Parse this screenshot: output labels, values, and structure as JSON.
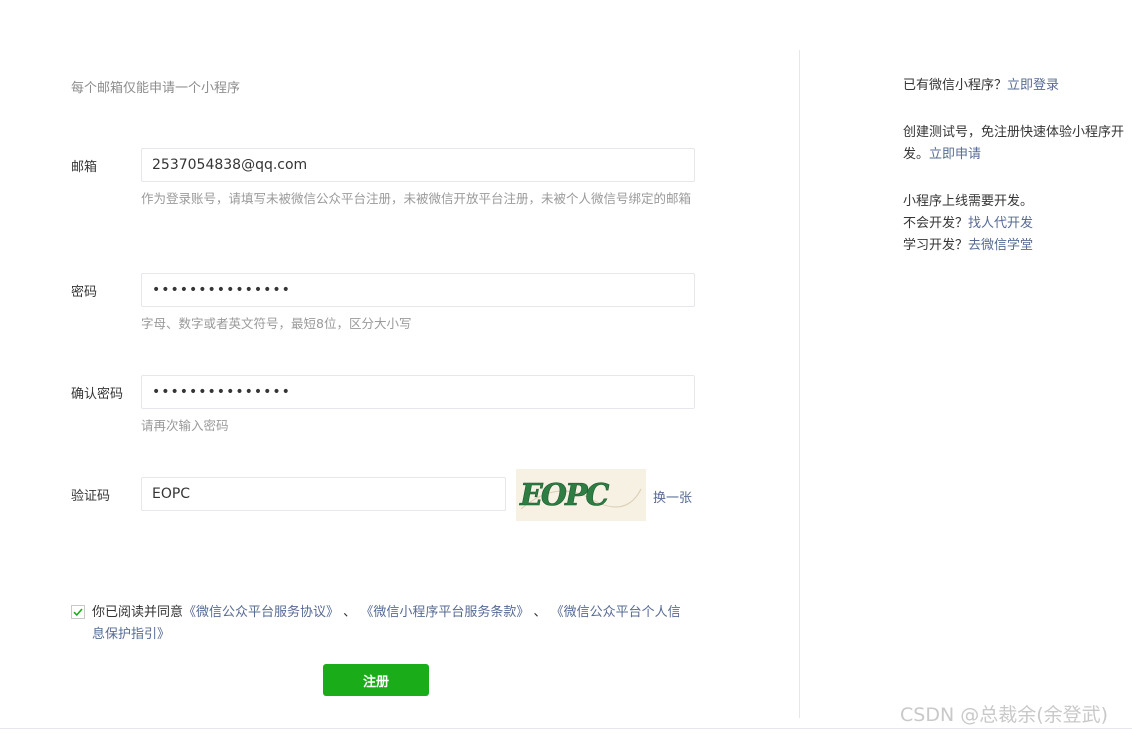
{
  "form": {
    "tip": "每个邮箱仅能申请一个小程序",
    "email": {
      "label": "邮箱",
      "value": "2537054838@qq.com",
      "help": "作为登录账号，请填写未被微信公众平台注册，未被微信开放平台注册，未被个人微信号绑定的邮箱"
    },
    "password": {
      "label": "密码",
      "value": "•••••••••••••••",
      "help": "字母、数字或者英文符号，最短8位，区分大小写"
    },
    "confirm": {
      "label": "确认密码",
      "value": "•••••••••••••••",
      "help": "请再次输入密码"
    },
    "captcha": {
      "label": "验证码",
      "value": "EOPC",
      "image_text": "EOPC",
      "swap_label": "换一张"
    },
    "agreement": {
      "checked": true,
      "prefix": "你已阅读并同意",
      "link1": "《微信公众平台服务协议》",
      "sep1": "、",
      "link2": "《微信小程序平台服务条款》",
      "sep2": "、",
      "link3": "《微信公众平台个人信息保护指引》"
    },
    "submit_label": "注册"
  },
  "sidebar": {
    "has_account": "已有微信小程序？",
    "login_link": "立即登录",
    "test_account_text": "创建测试号，免注册快速体验小程序开",
    "test_account_text_2": "发。",
    "apply_link": "立即申请",
    "need_dev": "小程序上线需要开发。",
    "no_dev": "不会开发？",
    "find_dev_link": "找人代开发",
    "learn_dev": "学习开发？",
    "school_link": "去微信学堂"
  },
  "watermark": "CSDN @总裁余(余登武)",
  "colors": {
    "link": "#576b95",
    "primary_button": "#1aad19",
    "checkbox_check": "#1aad19"
  }
}
